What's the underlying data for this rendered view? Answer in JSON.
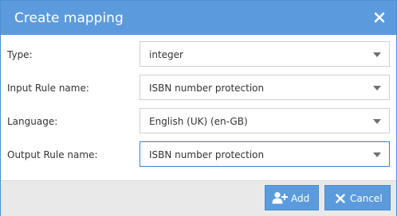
{
  "dialog": {
    "title": "Create mapping",
    "close_icon": "close-icon"
  },
  "form": {
    "type": {
      "label": "Type:",
      "value": "integer"
    },
    "input_rule": {
      "label": "Input Rule name:",
      "value": "ISBN number protection"
    },
    "language": {
      "label": "Language:",
      "value": "English (UK) (en-GB)"
    },
    "output_rule": {
      "label": "Output Rule name:",
      "value": "ISBN number protection"
    }
  },
  "footer": {
    "add_label": "Add",
    "add_icon": "add-user-icon",
    "cancel_label": "Cancel",
    "cancel_icon": "close-icon"
  },
  "colors": {
    "titlebar": "#5b9bdd",
    "button": "#5b9bdd",
    "footer": "#e9e9e9",
    "active_border": "#3a7fcf"
  }
}
